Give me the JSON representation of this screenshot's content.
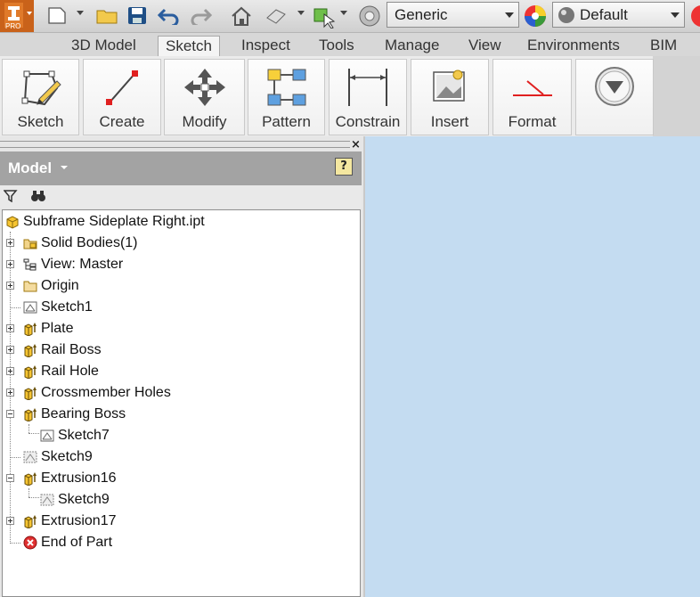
{
  "app": {
    "badge": "PRO"
  },
  "quick_access": {
    "material": "Generic",
    "appearance": "Default"
  },
  "tabs": [
    "3D Model",
    "Sketch",
    "Inspect",
    "Tools",
    "Manage",
    "View",
    "Environments",
    "BIM"
  ],
  "active_tab": "Sketch",
  "ribbon": {
    "sketch": "Sketch",
    "create": "Create",
    "modify": "Modify",
    "pattern": "Pattern",
    "constrain": "Constrain",
    "insert": "Insert",
    "format": "Format"
  },
  "browser": {
    "title": "Model",
    "help": "?",
    "close": "×",
    "tree": [
      {
        "label": "Subframe Sideplate Right.ipt",
        "icon": "part-icon",
        "expander": "none"
      },
      {
        "label": "Solid Bodies(1)",
        "icon": "folder-bodies-icon",
        "expander": "plus"
      },
      {
        "label": "View: Master",
        "icon": "view-rep-icon",
        "expander": "plus"
      },
      {
        "label": "Origin",
        "icon": "folder-icon",
        "expander": "plus"
      },
      {
        "label": "Sketch1",
        "icon": "sketch-icon",
        "expander": "none"
      },
      {
        "label": "Plate",
        "icon": "extrude-icon",
        "expander": "plus"
      },
      {
        "label": "Rail Boss",
        "icon": "extrude-icon",
        "expander": "plus"
      },
      {
        "label": "Rail Hole",
        "icon": "extrude-icon",
        "expander": "plus"
      },
      {
        "label": "Crossmember Holes",
        "icon": "extrude-icon",
        "expander": "plus"
      },
      {
        "label": "Bearing Boss",
        "icon": "extrude-icon",
        "expander": "minus"
      },
      {
        "label": "Sketch7",
        "icon": "sketch-icon",
        "expander": "child"
      },
      {
        "label": "Sketch9",
        "icon": "shared-sketch-icon",
        "expander": "none"
      },
      {
        "label": "Extrusion16",
        "icon": "extrude-icon",
        "expander": "minus"
      },
      {
        "label": "Sketch9",
        "icon": "shared-sketch-icon",
        "expander": "child"
      },
      {
        "label": "Extrusion17",
        "icon": "extrude-icon",
        "expander": "plus"
      },
      {
        "label": "End of Part",
        "icon": "end-of-part-icon",
        "expander": "none"
      }
    ]
  },
  "colors": {
    "viewport": "#c4dcf1",
    "accent": "#c9621a",
    "tab_active": "#f4f4f4"
  }
}
